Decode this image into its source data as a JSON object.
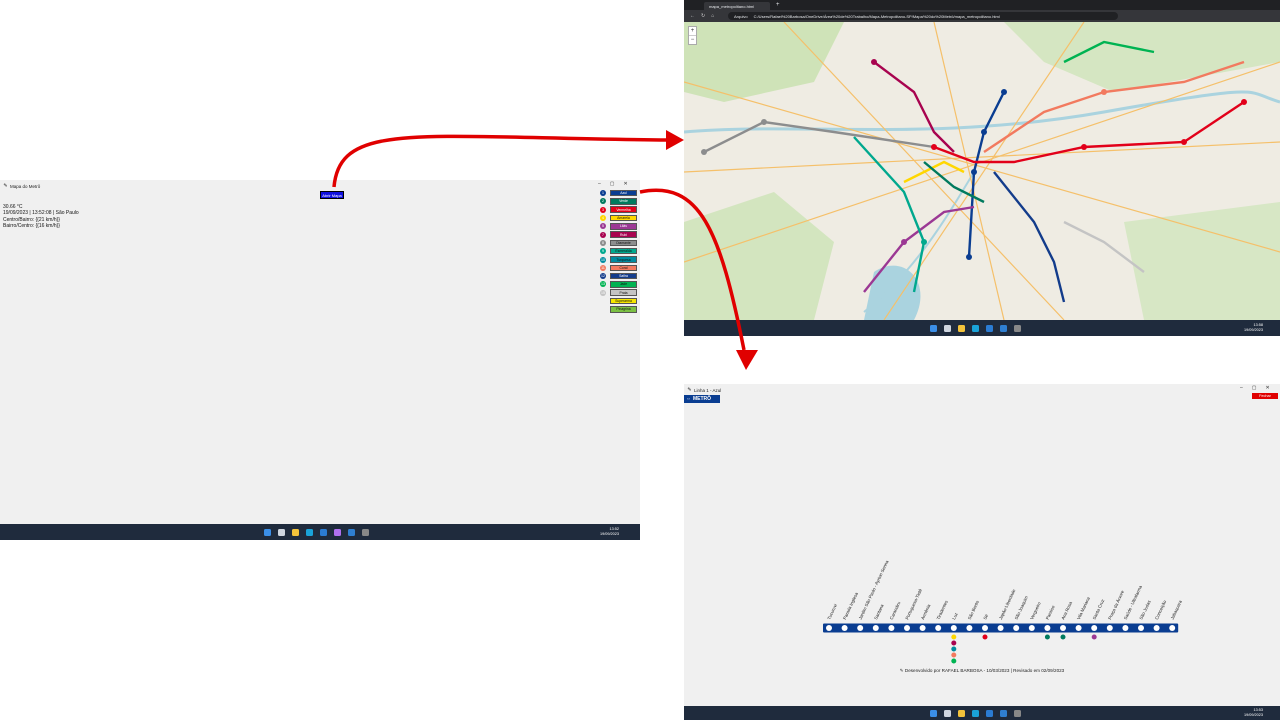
{
  "left_window": {
    "title": "Mapa do Metrô",
    "controls": [
      "–",
      "▢",
      "✕"
    ],
    "open_map_label": "Abrir Mapa",
    "info": {
      "temperature": "30.66 °C",
      "datetime": "19/09/2023 | 13:52:08 | São Paulo",
      "centro_bairro": "Centro/Bairro: {{21 km/h}}",
      "bairro_centro": "Bairro/Centro: {{16 km/h}}"
    },
    "lines": [
      {
        "num": "1",
        "label": "Azul",
        "color": "#0a3d91",
        "text": "#ffffff"
      },
      {
        "num": "2",
        "label": "Verde",
        "color": "#007a5e",
        "text": "#ffffff"
      },
      {
        "num": "3",
        "label": "Vermelha",
        "color": "#e2001a",
        "text": "#ffffff"
      },
      {
        "num": "4",
        "label": "Amarela",
        "color": "#ffd700",
        "text": "#111111"
      },
      {
        "num": "5",
        "label": "Lilás",
        "color": "#9b3894",
        "text": "#ffffff"
      },
      {
        "num": "7",
        "label": "Rubi",
        "color": "#a8034f",
        "text": "#ffffff"
      },
      {
        "num": "8",
        "label": "Diamante",
        "color": "#8c8d8e",
        "text": "#111111"
      },
      {
        "num": "9",
        "label": "Esmeralda",
        "color": "#00a88e",
        "text": "#111111"
      },
      {
        "num": "10",
        "label": "Turquesa",
        "color": "#008b9f",
        "text": "#111111"
      },
      {
        "num": "11",
        "label": "Coral",
        "color": "#f27a5f",
        "text": "#111111"
      },
      {
        "num": "12",
        "label": "Safira",
        "color": "#133c8b",
        "text": "#ffffff"
      },
      {
        "num": "13",
        "label": "Jade",
        "color": "#00b352",
        "text": "#111111"
      },
      {
        "num": "15",
        "label": "Prata",
        "color": "#c4c4c4",
        "text": "#111111"
      },
      {
        "num": "",
        "label": "Superarma",
        "color": "#f6e600",
        "text": "#111111"
      },
      {
        "num": "",
        "label": "Pinagrina",
        "color": "#7bc043",
        "text": "#111111"
      }
    ],
    "taskbar_time": "13:52",
    "taskbar_date": "19/09/2023"
  },
  "browser": {
    "tab_title": "mapa_metropolitano.html",
    "new_tab": "+",
    "address_prefix": "Arquivo",
    "address": "C:/Users/Rafael%20Barbosa/OneDrive/Área%20de%20Trabalho/Mapa-Metropolitano-SP/Mapa%20do%20Metrô/mapa_metropolitano.html",
    "zoom_in": "+",
    "zoom_out": "−",
    "taskbar_time": "13:58",
    "taskbar_date": "19/09/2023"
  },
  "line_window": {
    "title": "Linha 1 - Azul",
    "logo_text": "METRÔ",
    "close_label": "Fechar",
    "line_color": "#0a3d91",
    "stations": [
      "Tucuruvi",
      "Parada Inglesa",
      "Jardim São Paulo - Ayrton Senna",
      "Santana",
      "Carandiru",
      "Portuguesa-Tietê",
      "Armênia",
      "Tiradentes",
      "Luz",
      "São Bento",
      "Sé",
      "Japão-Liberdade",
      "São Joaquim",
      "Vergueiro",
      "Paraíso",
      "Ana Rosa",
      "Vila Mariana",
      "Santa Cruz",
      "Praça da Árvore",
      "Saúde - Ultrafarma",
      "São Judas",
      "Conceição",
      "Jabaquara"
    ],
    "connections": {
      "Luz": [
        "4",
        "7",
        "10",
        "11",
        "13"
      ],
      "Sé": [
        "3"
      ],
      "Paraíso": [
        "2"
      ],
      "Ana Rosa": [
        "2"
      ],
      "Santa Cruz": [
        "5"
      ]
    },
    "credits": "Desenvolvido por RAFAEL BARBOSA - 10/03/2023 | Revisado em 02/09/2023",
    "taskbar_time": "13:53",
    "taskbar_date": "19/09/2023"
  }
}
